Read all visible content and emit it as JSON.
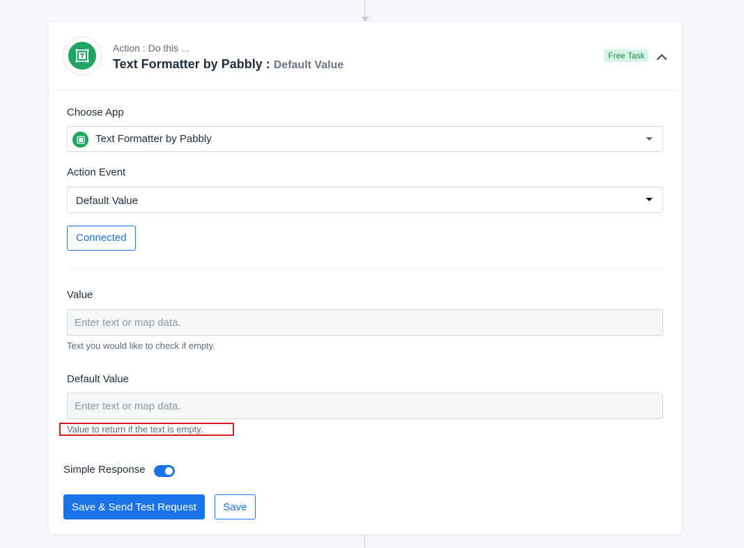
{
  "header": {
    "subtitle": "Action : Do this ...",
    "app_name": "Text Formatter by Pabbly :",
    "event_name": "Default Value",
    "badge": "Free Task"
  },
  "choose_app": {
    "label": "Choose App",
    "value": "Text Formatter by Pabbly"
  },
  "action_event": {
    "label": "Action Event",
    "value": "Default Value"
  },
  "connected_label": "Connected",
  "value_field": {
    "label": "Value",
    "placeholder": "Enter text or map data.",
    "help": "Text you would like to check if empty."
  },
  "default_value_field": {
    "label": "Default Value",
    "placeholder": "Enter text or map data.",
    "help": "Value to return if the text is empty."
  },
  "simple_response": {
    "label": "Simple Response",
    "enabled": true
  },
  "buttons": {
    "save_send": "Save & Send Test Request",
    "save": "Save"
  },
  "colors": {
    "brand_green": "#1fa463",
    "primary_blue": "#1a73e8",
    "highlight_red": "#e0191e"
  }
}
